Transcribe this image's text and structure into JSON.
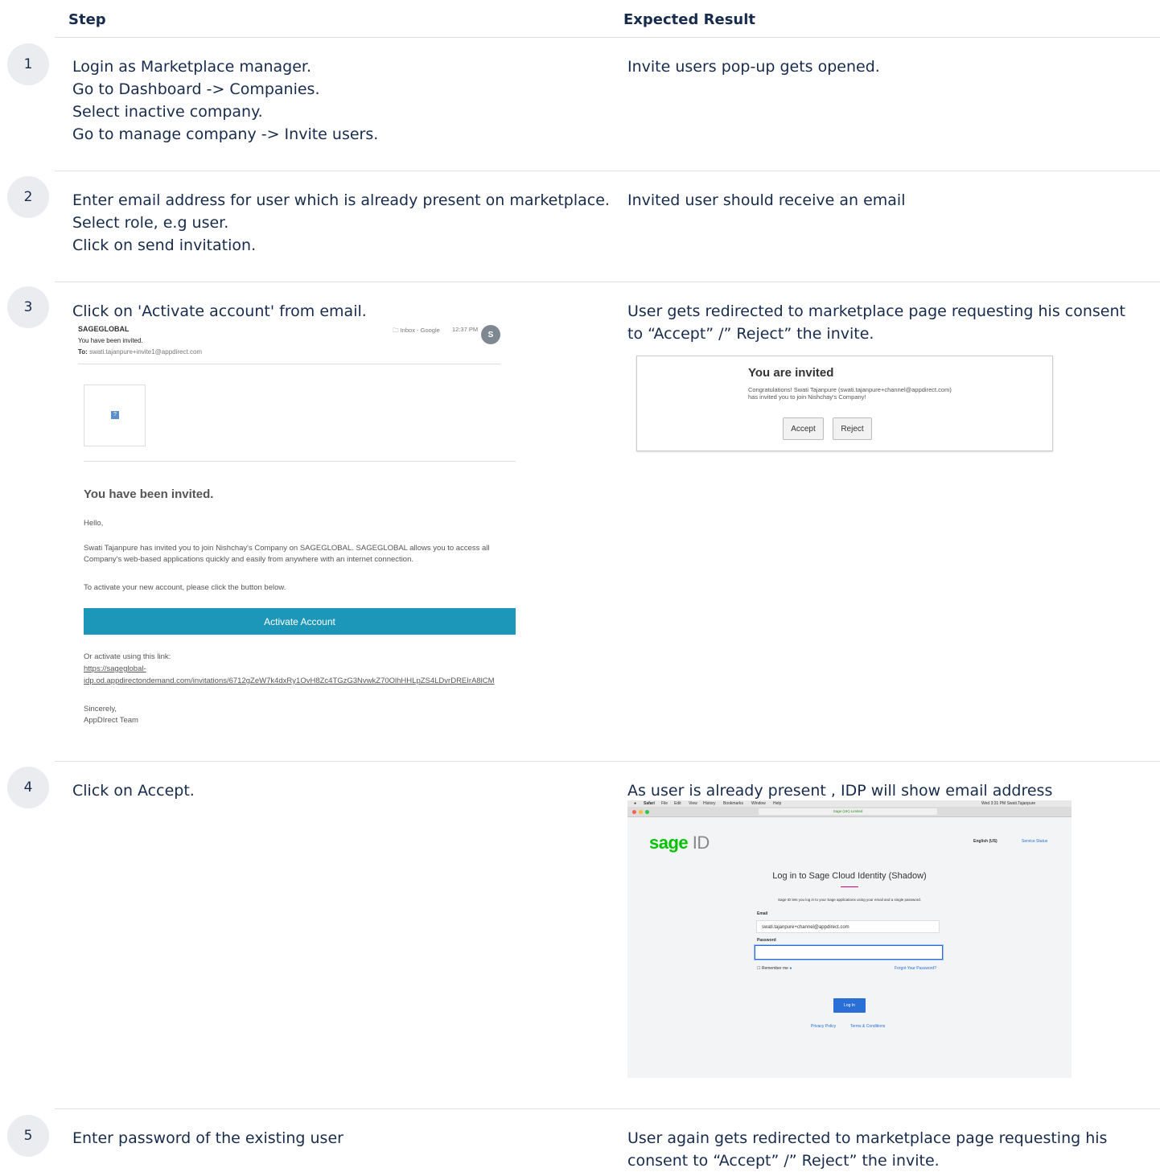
{
  "headers": {
    "step": "Step",
    "expected": "Expected Result"
  },
  "rows": [
    {
      "num": "1",
      "step": [
        "Login as Marketplace manager.",
        "Go to Dashboard -> Companies.",
        "Select inactive company.",
        "Go to manage company -> Invite users."
      ],
      "result": "Invite users pop-up gets opened."
    },
    {
      "num": "2",
      "step": [
        "Enter email address for user which is already present on marketplace.",
        "Select role, e.g user.",
        "Click on send invitation."
      ],
      "result": "Invited user should receive an email"
    },
    {
      "num": "3",
      "step": [
        "Click on 'Activate account' from email."
      ],
      "result": "User gets redirected to marketplace page requesting his consent to “Accept” /” Reject” the invite."
    },
    {
      "num": "4",
      "step": [
        "Click on Accept."
      ],
      "result": "As user is already present , IDP will show email address"
    },
    {
      "num": "5",
      "step": [
        "Enter password of the existing user"
      ],
      "result": "User again gets redirected to marketplace page requesting his consent to “Accept” /” Reject” the invite."
    }
  ],
  "email": {
    "sender": "SAGEGLOBAL",
    "subject": "You have been invited.",
    "to_label": "To:",
    "to": "swati.tajanpure+invite1@appdirect.com",
    "folder": "Inbox - Google",
    "time": "12:37 PM",
    "avatar": "S",
    "title": "You have been invited.",
    "hello": "Hello,",
    "body1": "Swati Tajanpure has invited you to join Nishchay's Company on SAGEGLOBAL. SAGEGLOBAL allows you to access all",
    "body2": "Company's web-based applications quickly and easily from anywhere with an internet connection.",
    "activate_text": "To activate your new account, please click the button below.",
    "button": "Activate Account",
    "or_text": "Or activate using this link:",
    "link1": "https://sageglobal-",
    "link2": "idp.od.appdirectondemand.com/invitations/6712gZeW7k4dxRy1OvH8Zc4TGzG3NvwkZ70OlhHHLpZS4LDvrDREIrA8lCM",
    "sincerely": "Sincerely,",
    "team": "AppDIrect Team"
  },
  "invite_card": {
    "title": "You are invited",
    "body": "Congratulations! Swati Tajanpure (swati.tajanpure+channel@appdirect.com) has invited you to join Nishchay's Company!",
    "accept": "Accept",
    "reject": "Reject"
  },
  "sage": {
    "menu": [
      "Safari",
      "File",
      "Edit",
      "View",
      "History",
      "Bookmarks",
      "Window",
      "Help"
    ],
    "status": "Wed 3:31 PM   Swati.Tajanpure",
    "url": "Sage (UK) Limited",
    "logo_main": "sage",
    "logo_id": " ID",
    "language": "English (US)",
    "service": "Service Status",
    "login_title": "Log in to Sage Cloud Identity (Shadow)",
    "login_sub": "Sage ID lets you log in to your Sage applications using your email and a single password.",
    "email_label": "Email",
    "email_value": "swati.tajanpure+channel@appdirect.com",
    "password_label": "Password",
    "remember": "Remember me",
    "forgot": "Forgot Your Password?",
    "login_button": "Log In",
    "privacy": "Privacy Policy",
    "terms": "Terms & Conditions"
  }
}
